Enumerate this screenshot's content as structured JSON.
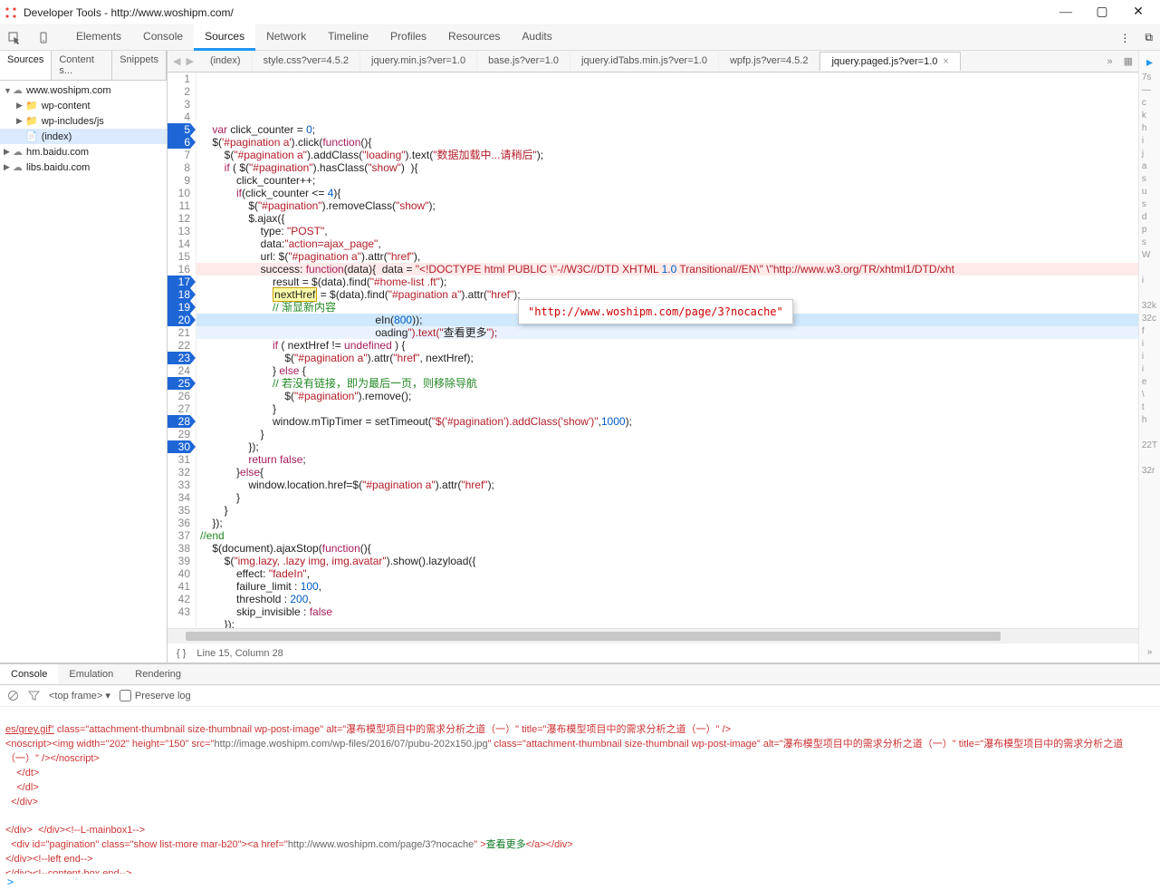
{
  "window": {
    "title": "Developer Tools - http://www.woshipm.com/",
    "min": "—",
    "max": "▢",
    "close": "✕"
  },
  "mainTabs": [
    "Elements",
    "Console",
    "Sources",
    "Network",
    "Timeline",
    "Profiles",
    "Resources",
    "Audits"
  ],
  "mainActive": 2,
  "navTabs": [
    "Sources",
    "Content s...",
    "Snippets"
  ],
  "navActive": 0,
  "tree": [
    {
      "d": 0,
      "tw": "▼",
      "icon": "cld",
      "label": "www.woshipm.com"
    },
    {
      "d": 1,
      "tw": "▶",
      "icon": "fld",
      "label": "wp-content"
    },
    {
      "d": 1,
      "tw": "▶",
      "icon": "fld",
      "label": "wp-includes/js"
    },
    {
      "d": 1,
      "tw": "",
      "icon": "doc",
      "label": "(index)",
      "sel": true
    },
    {
      "d": 0,
      "tw": "▶",
      "icon": "cld",
      "label": "hm.baidu.com"
    },
    {
      "d": 0,
      "tw": "▶",
      "icon": "cld",
      "label": "libs.baidu.com"
    }
  ],
  "fileTabs": [
    {
      "label": "(index)"
    },
    {
      "label": "style.css?ver=4.5.2"
    },
    {
      "label": "jquery.min.js?ver=1.0"
    },
    {
      "label": "base.js?ver=1.0"
    },
    {
      "label": "jquery.idTabs.min.js?ver=1.0"
    },
    {
      "label": "wpfp.js?ver=4.5.2"
    },
    {
      "label": "jquery.paged.js?ver=1.0",
      "active": true,
      "close": true
    }
  ],
  "code": {
    "start": 1,
    "breakpoints": [
      5,
      6,
      17,
      18,
      19,
      20,
      23,
      25,
      28,
      30
    ],
    "tooltipLine": 17,
    "tooltip": "\"http://www.woshipm.com/page/3?nocache\"",
    "lines": [
      "",
      "    var click_counter = 0;",
      "    $('#pagination a').click(function(){",
      "        $(\"#pagination a\").addClass(\"loading\").text(\"数据加载中...请稍后\");",
      "        if ( $(\"#pagination\").hasClass(\"show\")  ){",
      "            click_counter++;",
      "            if(click_counter <= 4){",
      "                $(\"#pagination\").removeClass(\"show\");",
      "                $.ajax({",
      "                    type: \"POST\",",
      "                    data:\"action=ajax_page\",",
      "                    url: $(\"#pagination a\").attr(\"href\"),",
      "                    success: function(data){  data = \"<!DOCTYPE html PUBLIC \\\"-//W3C//DTD XHTML 1.0 Transitional//EN\\\" \\\"http://www.w3.org/TR/xhtml1/DTD/xht",
      "                        result = $(data).find(\"#home-list .ft\");",
      "                        nextHref = $(data).find(\"#pagination a\").attr(\"href\");",
      "                        // 渐显新内容",
      "                                                          eIn(800));",
      "                                                          oading\").text(\"查看更多\");",
      "                        if ( nextHref != undefined ) {",
      "                            $(\"#pagination a\").attr(\"href\", nextHref);",
      "                        } else {",
      "                        // 若没有链接，即为最后一页，则移除导航",
      "                            $(\"#pagination\").remove();",
      "                        }",
      "                        window.mTipTimer = setTimeout(\"$('#pagination').addClass('show')\",1000);",
      "                    }",
      "                });",
      "                return false;",
      "            }else{",
      "                window.location.href=$(\"#pagination a\").attr(\"href\");",
      "            }",
      "        }",
      "    });",
      "//end",
      "    $(document).ajaxStop(function(){",
      "        $(\"img.lazy, .lazy img, img.avatar\").show().lazyload({",
      "            effect: \"fadeIn\",",
      "            failure_limit : 100,",
      "            threshold : 200,",
      "            skip_invisible : false",
      "        });",
      "    });",
      "});"
    ]
  },
  "status": {
    "braces": "{ }",
    "pos": "Line 15, Column 28"
  },
  "sideMarks": [
    "7s",
    "—",
    "c",
    "k",
    "h",
    "i",
    "j",
    "a",
    "s",
    "u",
    "s",
    "d",
    "p",
    "s",
    "W",
    "",
    "i",
    "",
    "32k",
    "32c",
    "f",
    "i",
    "i",
    "i",
    "e",
    "\\",
    "t",
    "h",
    "",
    "22T",
    "",
    "32r"
  ],
  "drawer": {
    "tabs": [
      "Console",
      "Emulation",
      "Rendering"
    ],
    "active": 0,
    "frame": "<top frame>",
    "preserve": "Preserve log",
    "console": {
      "l1a": "es/grey.gif\"",
      "l1b": " class=\"attachment-thumbnail size-thumbnail wp-post-image\" alt=\"瀑布模型项目中的需求分析之道（一）\" title=\"瀑布模型项目中的需求分析之道（一）\" />",
      "l2a": "<noscript><img width=\"202\" height=\"150\" src=\"",
      "l2b": "http://image.woshipm.com/wp-files/2016/07/pubu-202x150.jpg",
      "l2c": "\" class=\"attachment-thumbnail size-thumbnail wp-post-image\" alt=\"瀑布模型项目中的需求分析之道（一）\" title=\"瀑布模型项目中的需求分析之道（一）\" /></noscript>",
      "l3": "    </dt>",
      "l4": "    </dl>",
      "l5": "  </div>",
      "l6": "</div>  </div><!--L-mainbox1-->",
      "l7a": "  <div id=\"pagination\" class=\"show list-more mar-b20\"><a href=\"",
      "l7b": "http://www.woshipm.com/page/3?nocache",
      "l7c": "\" >",
      "l7d": "查看更多",
      "l7e": "</a></div>",
      "l8": "</div><!--left end-->",
      "l9": "</div><!--content-box end-->"
    },
    "prompt": ">"
  }
}
